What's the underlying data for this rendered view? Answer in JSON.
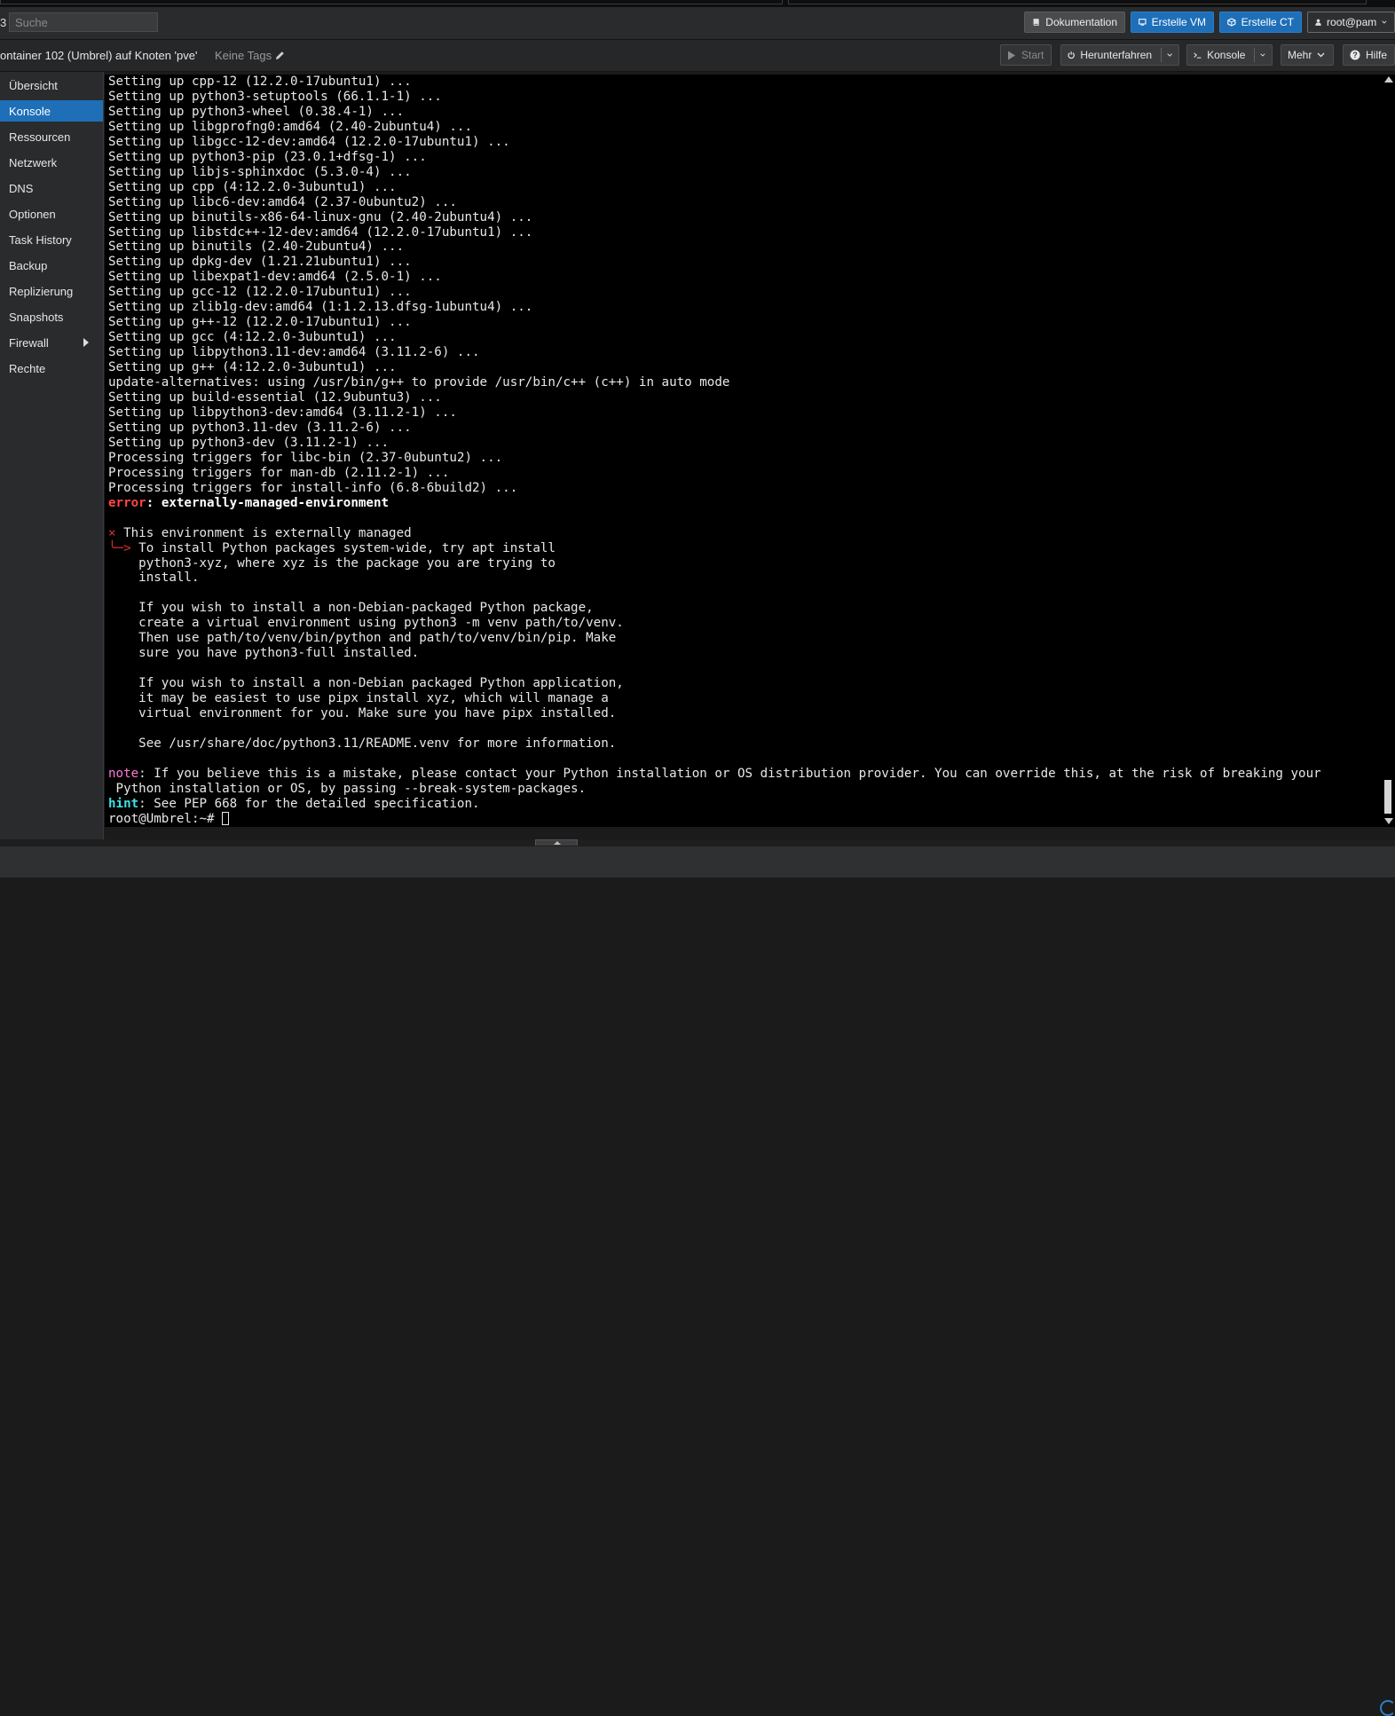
{
  "header": {
    "logo_fragment": "3",
    "search_placeholder": "Suche",
    "buttons": {
      "docs": "Dokumentation",
      "create_vm": "Erstelle VM",
      "create_ct": "Erstelle CT",
      "user": "root@pam"
    }
  },
  "toolbar": {
    "title": "ontainer 102 (Umbrel) auf Knoten 'pve'",
    "tags": "Keine Tags",
    "start": "Start",
    "shutdown": "Herunterfahren",
    "console": "Konsole",
    "more": "Mehr",
    "help": "Hilfe"
  },
  "sidebar": {
    "items": [
      {
        "label": "Übersicht"
      },
      {
        "label": "Konsole"
      },
      {
        "label": "Ressourcen"
      },
      {
        "label": "Netzwerk"
      },
      {
        "label": "DNS"
      },
      {
        "label": "Optionen"
      },
      {
        "label": "Task History"
      },
      {
        "label": "Backup"
      },
      {
        "label": "Replizierung"
      },
      {
        "label": "Snapshots"
      },
      {
        "label": "Firewall"
      },
      {
        "label": "Rechte"
      }
    ]
  },
  "terminal": {
    "install_lines": "Setting up cpp-12 (12.2.0-17ubuntu1) ...\nSetting up python3-setuptools (66.1.1-1) ...\nSetting up python3-wheel (0.38.4-1) ...\nSetting up libgprofng0:amd64 (2.40-2ubuntu4) ...\nSetting up libgcc-12-dev:amd64 (12.2.0-17ubuntu1) ...\nSetting up python3-pip (23.0.1+dfsg-1) ...\nSetting up libjs-sphinxdoc (5.3.0-4) ...\nSetting up cpp (4:12.2.0-3ubuntu1) ...\nSetting up libc6-dev:amd64 (2.37-0ubuntu2) ...\nSetting up binutils-x86-64-linux-gnu (2.40-2ubuntu4) ...\nSetting up libstdc++-12-dev:amd64 (12.2.0-17ubuntu1) ...\nSetting up binutils (2.40-2ubuntu4) ...\nSetting up dpkg-dev (1.21.21ubuntu1) ...\nSetting up libexpat1-dev:amd64 (2.5.0-1) ...\nSetting up gcc-12 (12.2.0-17ubuntu1) ...\nSetting up zlib1g-dev:amd64 (1:1.2.13.dfsg-1ubuntu4) ...\nSetting up g++-12 (12.2.0-17ubuntu1) ...\nSetting up gcc (4:12.2.0-3ubuntu1) ...\nSetting up libpython3.11-dev:amd64 (3.11.2-6) ...\nSetting up g++ (4:12.2.0-3ubuntu1) ...\nupdate-alternatives: using /usr/bin/g++ to provide /usr/bin/c++ (c++) in auto mode\nSetting up build-essential (12.9ubuntu3) ...\nSetting up libpython3-dev:amd64 (3.11.2-1) ...\nSetting up python3.11-dev (3.11.2-6) ...\nSetting up python3-dev (3.11.2-1) ...\nProcessing triggers for libc-bin (2.37-0ubuntu2) ...\nProcessing triggers for man-db (2.11.2-1) ...\nProcessing triggers for install-info (6.8-6build2) ...",
    "error_label": "error",
    "error_colon": ": ",
    "error_name": "externally-managed-environment",
    "x_mark": "×",
    "managed_msg": " This environment is externally managed",
    "arrow_mark": "╰─>",
    "explain_first": " To install Python packages system-wide, try apt install",
    "explain_rest": "    python3-xyz, where xyz is the package you are trying to\n    install.\n\n    If you wish to install a non-Debian-packaged Python package,\n    create a virtual environment using python3 -m venv path/to/venv.\n    Then use path/to/venv/bin/python and path/to/venv/bin/pip. Make\n    sure you have python3-full installed.\n\n    If you wish to install a non-Debian packaged Python application,\n    it may be easiest to use pipx install xyz, which will manage a\n    virtual environment for you. Make sure you have pipx installed.\n\n    See /usr/share/doc/python3.11/README.venv for more information.",
    "note_label": "note",
    "note_text": ": If you believe this is a mistake, please contact your Python installation or OS distribution provider. You can override this, at the risk of breaking your\n Python installation or OS, by passing --break-system-packages.",
    "hint_label": "hint",
    "hint_text": ": See PEP 668 for the detailed specification.",
    "prompt": "root@Umbrel:~# "
  }
}
